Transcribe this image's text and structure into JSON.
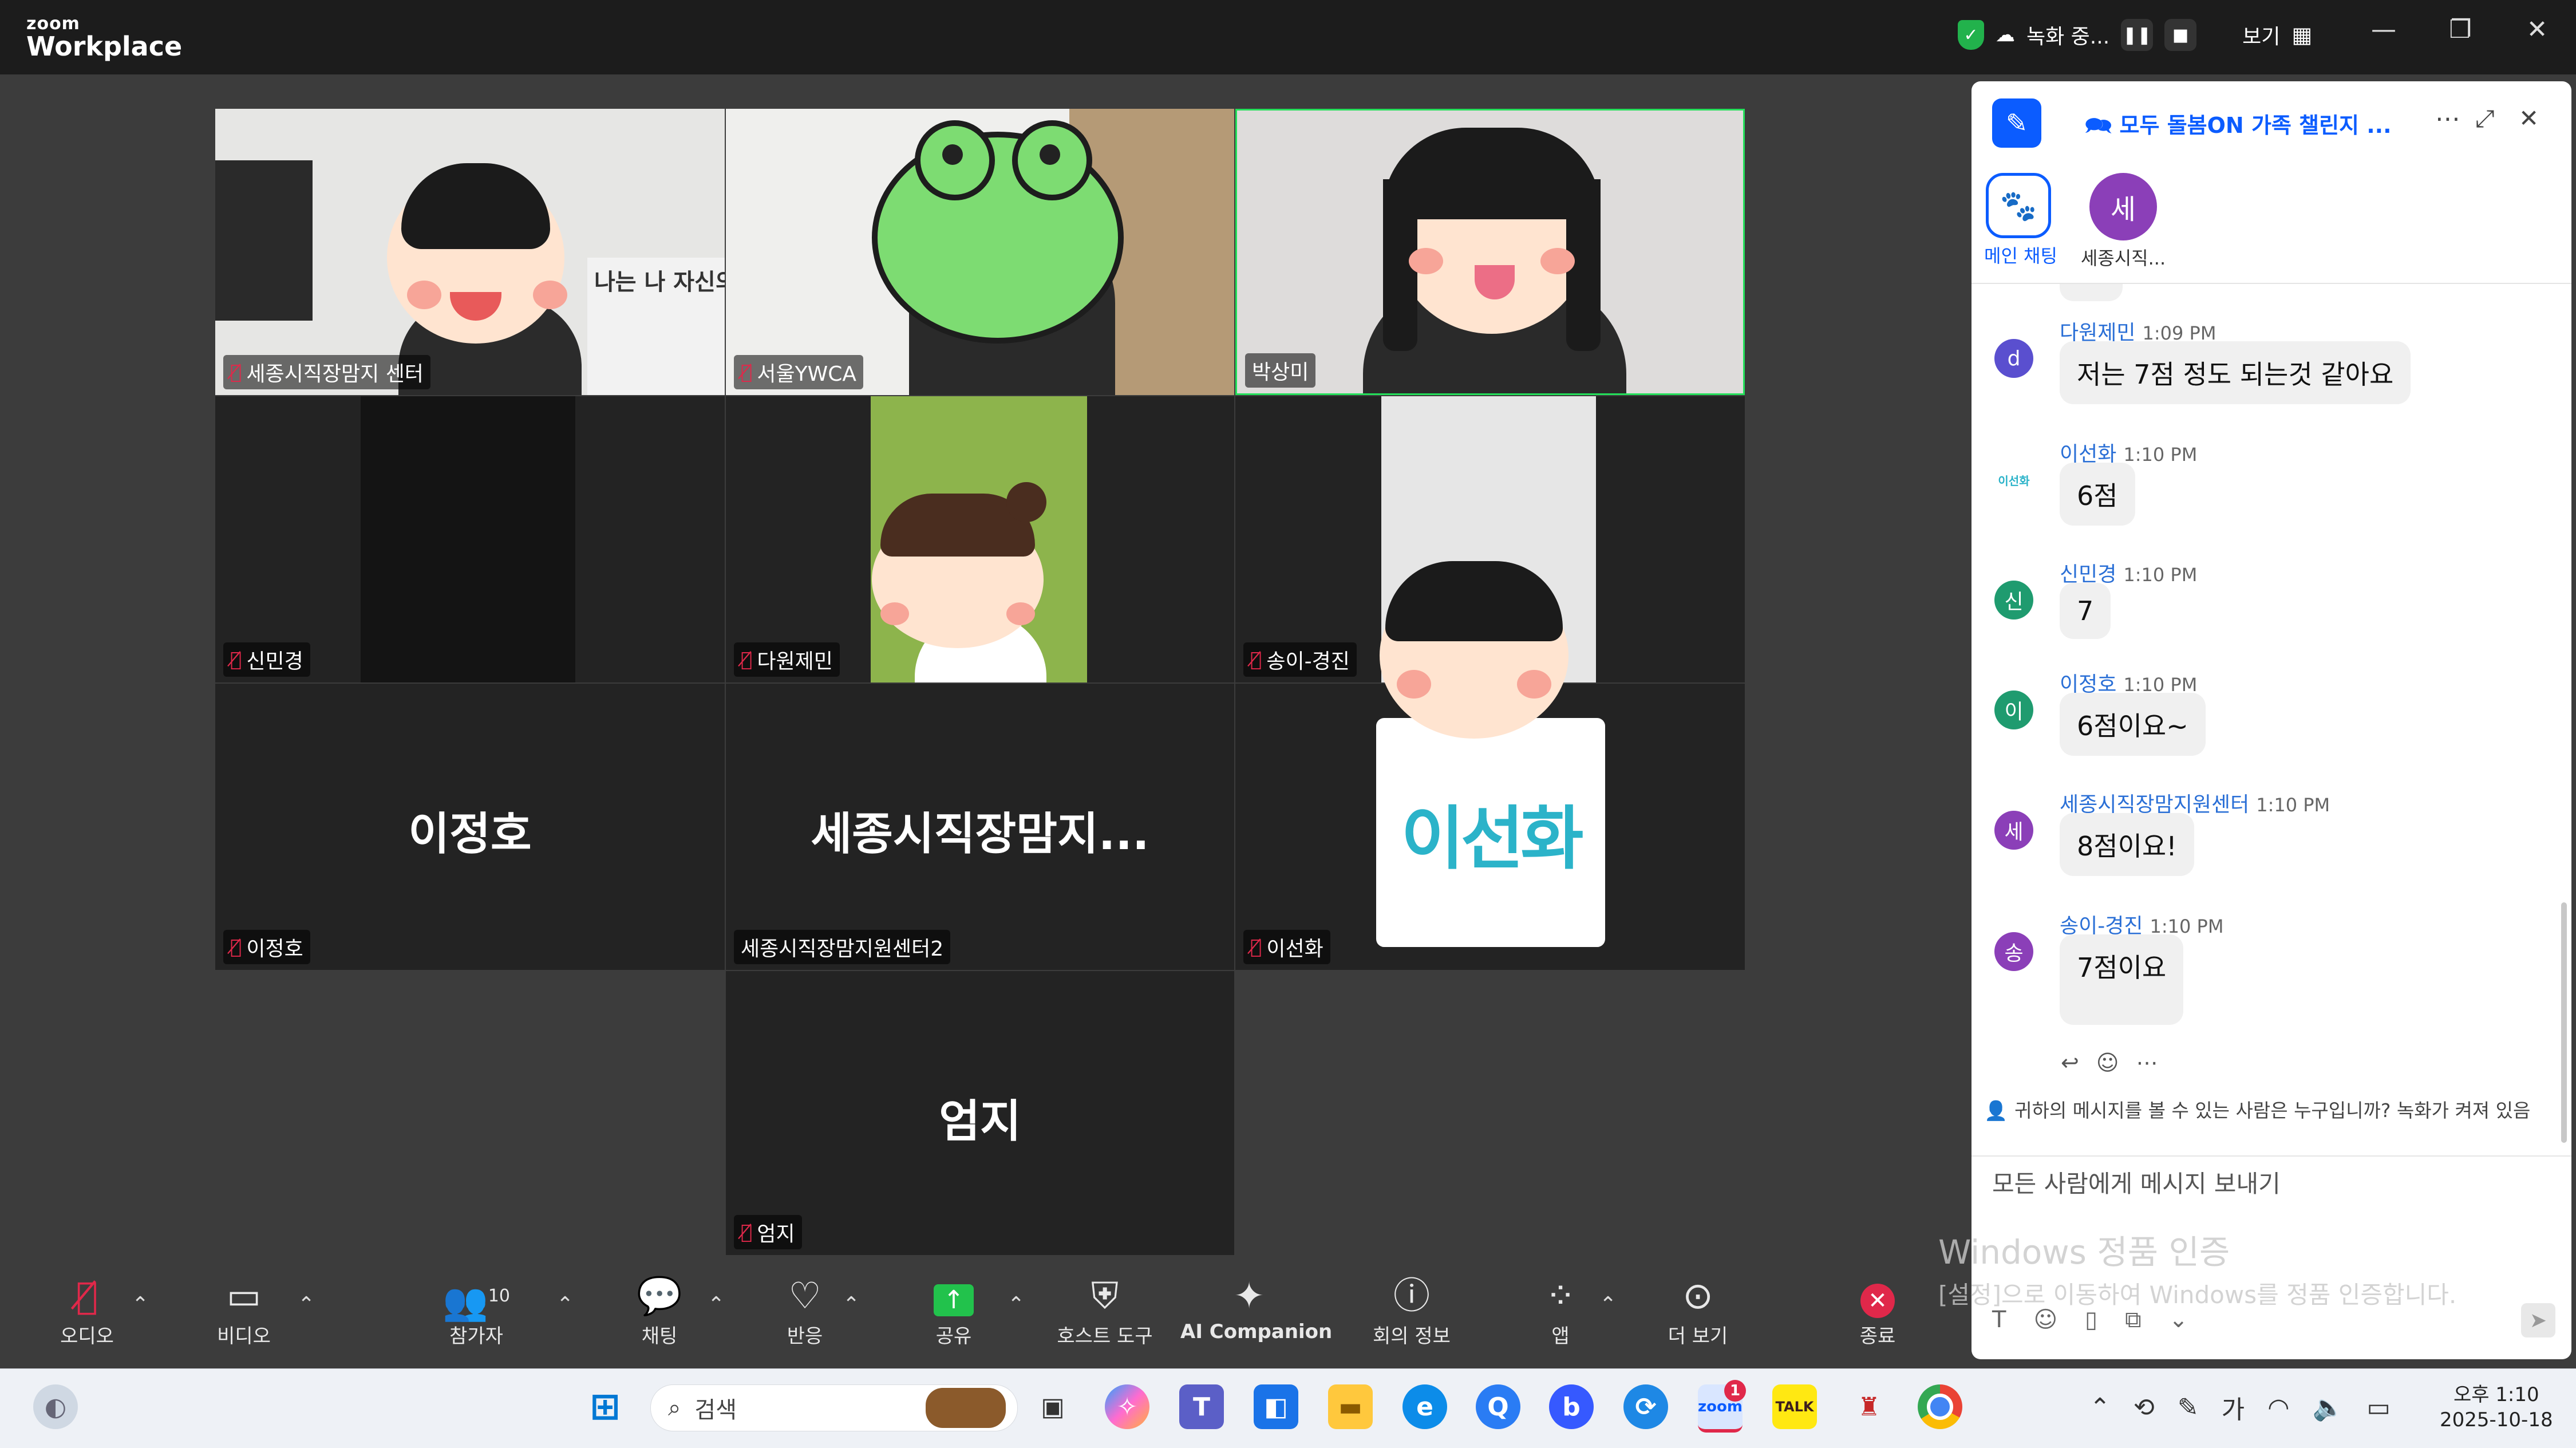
{
  "app": {
    "brand_small": "zoom",
    "brand_big": "Workplace"
  },
  "titlebar": {
    "recording_label": "녹화 중...",
    "view_label": "보기"
  },
  "tiles": [
    {
      "name": "세종시직장맘지  센터",
      "banner_text": "나는 나 자신의",
      "muted": true
    },
    {
      "name": "서울YWCA",
      "muted": true
    },
    {
      "name": "박상미",
      "muted": false
    },
    {
      "name": "신민경",
      "muted": true
    },
    {
      "name": "다원제민",
      "muted": true
    },
    {
      "name": "송이-경진",
      "muted": true
    },
    {
      "name": "이정호",
      "center_name": "이정호",
      "muted": true
    },
    {
      "name": "세종시직장맘지원센터2",
      "center_name": "세종시직장맘지...",
      "muted": false
    },
    {
      "name": "이선화",
      "center_name": "이선화",
      "muted": true
    },
    {
      "name": "엄지",
      "center_name": "엄지",
      "muted": true
    }
  ],
  "chat": {
    "title": "모두 돌봄ON 가족 챌린지 ...",
    "tabs": [
      {
        "label": "메인 채팅"
      },
      {
        "label": "세종시직...",
        "initial": "세"
      }
    ],
    "messages": [
      {
        "sender": "다원제민",
        "time": "1:09 PM",
        "text": "저는 7점 정도 되는것 같아요",
        "avatar": "d",
        "color": "#5a4fcf"
      },
      {
        "sender": "이선화",
        "time": "1:10 PM",
        "text": "6점",
        "avatar": "이선화",
        "color": "#ffffff"
      },
      {
        "sender": "신민경",
        "time": "1:10 PM",
        "text": "7",
        "avatar": "신",
        "color": "#1f9b6f"
      },
      {
        "sender": "이정호",
        "time": "1:10 PM",
        "text": "6점이요~",
        "avatar": "이",
        "color": "#1f9b6f"
      },
      {
        "sender": "세종시직장맘지원센터",
        "time": "1:10 PM",
        "text": "8점이요!",
        "avatar": "세",
        "color": "#8b3fb8"
      },
      {
        "sender": "송이-경진",
        "time": "1:10 PM",
        "text": "7점이요",
        "avatar": "송",
        "color": "#8b3fb8"
      }
    ],
    "visibility_note": "귀하의 메시지를 볼 수 있는 사람은 누구입니까? 녹화가 켜져 있음",
    "input_placeholder": "모든 사람에게 메시지 보내기"
  },
  "watermark": {
    "line1": "Windows 정품 인증",
    "line2": "[설정]으로 이동하여 Windows를 정품 인증합니다."
  },
  "toolbar": {
    "audio": "오디오",
    "video": "비디오",
    "participants": "참가자",
    "participants_count": "10",
    "chat": "채팅",
    "react": "반응",
    "share": "공유",
    "host_tools": "호스트 도구",
    "ai": "AI Companion",
    "meeting_info": "회의 정보",
    "apps": "앱",
    "more": "더 보기",
    "end": "종료"
  },
  "taskbar": {
    "search_placeholder": "검색",
    "ime": "가",
    "time": "오후 1:10",
    "date": "2025-10-18",
    "zoom_badge": "1",
    "kakao": "TALK"
  }
}
